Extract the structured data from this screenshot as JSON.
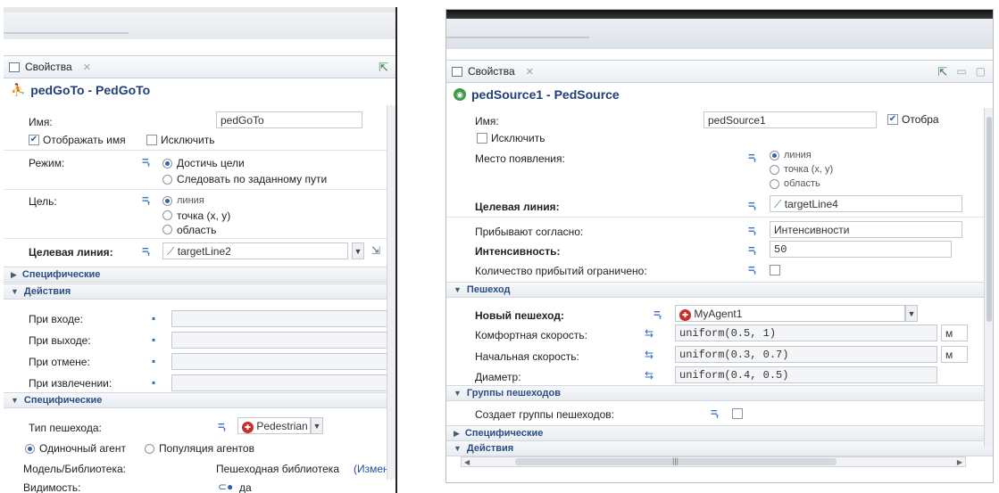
{
  "left": {
    "tab": {
      "label": "Свойства",
      "close": "✕"
    },
    "title": "pedGoTo - PedGoTo",
    "name": {
      "label": "Имя:",
      "value": "pedGoTo"
    },
    "show_name": "Отображать имя",
    "exclude": "Исключить",
    "mode": {
      "label": "Режим:",
      "options": [
        "Достичь цели",
        "Следовать по заданному пути"
      ]
    },
    "target": {
      "label": "Цель:",
      "options": [
        "линия",
        "точка (x, y)",
        "область"
      ]
    },
    "target_line": {
      "label": "Целевая линия:",
      "value": "targetLine2"
    },
    "section_specific_collapsed": "Специфические",
    "section_actions": "Действия",
    "actions": [
      "При входе:",
      "При выходе:",
      "При отмене:",
      "При извлечении:"
    ],
    "section_specific": "Специфические",
    "ped_type": {
      "label": "Тип пешехода:",
      "value": "Pedestrian"
    },
    "agent_mode": [
      "Одиночный агент",
      "Популяция агентов"
    ],
    "model_library": {
      "label": "Модель/Библиотека:",
      "value": "Пешеходная библиотека",
      "link": "(Измен"
    },
    "visibility": {
      "label": "Видимость:",
      "value": "да"
    }
  },
  "right": {
    "tab": {
      "label": "Свойства",
      "close": "✕"
    },
    "title": "pedSource1 - PedSource",
    "name": {
      "label": "Имя:",
      "value": "pedSource1"
    },
    "show_name": "Отобра",
    "exclude": "Исключить",
    "spawn": {
      "label": "Место появления:",
      "options": [
        "линия",
        "точка (x, y)",
        "область"
      ]
    },
    "target_line": {
      "label": "Целевая линия:",
      "value": "targetLine4"
    },
    "arrive": {
      "label": "Прибывают согласно:",
      "value": "Интенсивности"
    },
    "intensity": {
      "label": "Интенсивность:",
      "value": "50"
    },
    "limited": {
      "label": "Количество прибытий ограничено:"
    },
    "section_ped": "Пешеход",
    "new_ped": {
      "label": "Новый пешеход:",
      "value": "MyAgent1"
    },
    "comfort": {
      "label": "Комфортная скорость:",
      "value": "uniform(0.5, 1)",
      "unit": "м"
    },
    "initial": {
      "label": "Начальная скорость:",
      "value": "uniform(0.3, 0.7)",
      "unit": "м"
    },
    "diameter": {
      "label": "Диаметр:",
      "value": "uniform(0.4, 0.5)"
    },
    "section_groups": "Группы пешеходов",
    "groups": {
      "label": "Создает группы пешеходов:"
    },
    "section_specific": "Специфические",
    "section_actions": "Действия"
  }
}
